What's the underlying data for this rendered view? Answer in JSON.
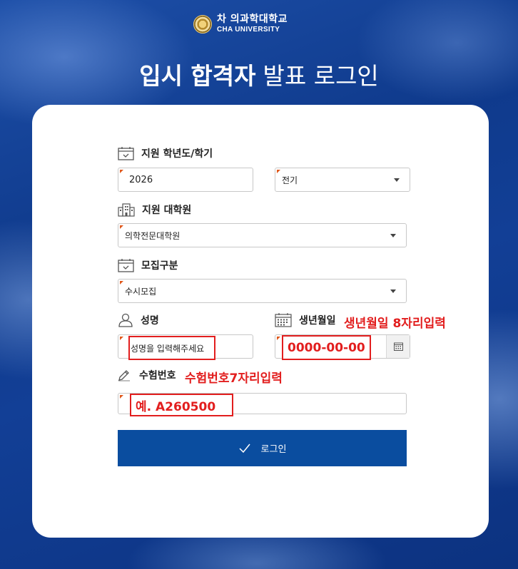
{
  "header": {
    "logo_kr": "차 의과학대학교",
    "logo_en": "CHA UNIVERSITY",
    "title_strong": "입시 합격자",
    "title_light": "발표 로그인"
  },
  "form": {
    "year_term_label": "지원 학년도/학기",
    "year_value": "2026",
    "term_value": "전기",
    "graduate_school_label": "지원 대학원",
    "graduate_school_value": "의학전문대학원",
    "recruit_type_label": "모집구분",
    "recruit_type_value": "수시모집",
    "name_label": "성명",
    "name_placeholder": "성명을 입력해주세요",
    "birth_label": "생년월일",
    "birth_note": "생년월일 8자리입력",
    "birth_placeholder": "0000-00-00",
    "exam_no_label": "수험번호",
    "exam_no_note": "수험번호7자리입력",
    "exam_no_placeholder": "예. A260500",
    "login_label": "로그인"
  },
  "icons": {
    "calendar": "calendar-icon",
    "building": "building-icon",
    "checklist": "calendar-check-icon",
    "person": "person-icon",
    "birth_calendar": "calendar-grid-icon",
    "pencil": "pencil-icon",
    "check": "check-icon"
  },
  "colors": {
    "primary_button": "#0a4d9f",
    "annotation_red": "#e21e1e",
    "required_mark": "#e0581c"
  }
}
